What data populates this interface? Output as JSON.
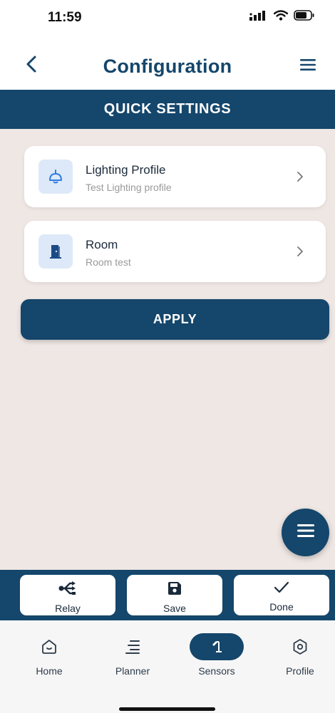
{
  "status_bar": {
    "time": "11:59",
    "icons": [
      "signal-icon",
      "wifi-icon",
      "battery-icon"
    ]
  },
  "header": {
    "title": "Configuration",
    "back_icon": "chevron-left-icon",
    "menu_icon": "hamburger-menu-icon"
  },
  "section": {
    "title": "QUICK SETTINGS"
  },
  "cards": [
    {
      "title": "Lighting Profile",
      "subtitle": "Test Lighting profile",
      "icon": "ceiling-lamp-icon"
    },
    {
      "title": "Room",
      "subtitle": "Room test",
      "icon": "door-icon"
    }
  ],
  "apply": {
    "label": "APPLY"
  },
  "fab": {
    "icon": "menu-icon"
  },
  "actions": [
    {
      "label": "Relay",
      "icon": "relay-share-icon"
    },
    {
      "label": "Save",
      "icon": "save-icon"
    },
    {
      "label": "Done",
      "icon": "check-icon"
    }
  ],
  "tabs": [
    {
      "label": "Home",
      "icon": "home-icon",
      "active": false
    },
    {
      "label": "Planner",
      "icon": "planner-list-icon",
      "active": false
    },
    {
      "label": "Sensors",
      "icon": "sensor-lamp-icon",
      "active": true
    },
    {
      "label": "Profile",
      "icon": "profile-hex-icon",
      "active": false
    }
  ],
  "colors": {
    "primary": "#15466b",
    "background": "#efe7e4",
    "icon_tile": "#dde9f8",
    "card": "#ffffff"
  }
}
